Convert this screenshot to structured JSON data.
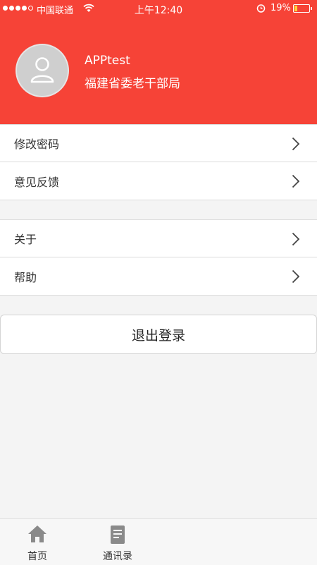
{
  "status_bar": {
    "carrier": "中国联通",
    "time": "上午12:40",
    "battery": "19%"
  },
  "profile": {
    "name": "APPtest",
    "organization": "福建省委老干部局"
  },
  "menu_group_1": [
    {
      "label": "修改密码"
    },
    {
      "label": "意见反馈"
    }
  ],
  "menu_group_2": [
    {
      "label": "关于"
    },
    {
      "label": "帮助"
    }
  ],
  "logout_label": "退出登录",
  "tabbar": {
    "tabs": [
      {
        "label": "首页",
        "icon": "home-icon"
      },
      {
        "label": "通讯录",
        "icon": "contacts-book-icon"
      }
    ]
  },
  "colors": {
    "header": "#f64337",
    "background": "#f4f4f4"
  }
}
